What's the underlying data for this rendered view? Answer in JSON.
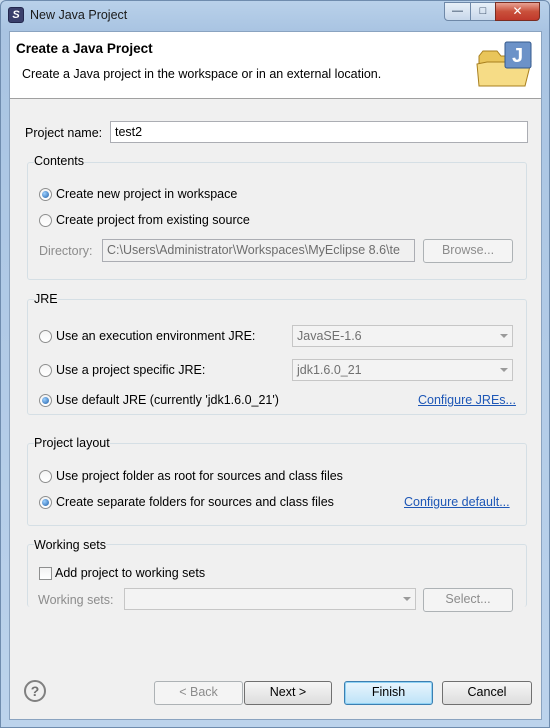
{
  "window": {
    "title": "New Java Project",
    "app_icon": "eclipse-icon",
    "controls": {
      "minimize": "—",
      "maximize": "□",
      "close": "✕"
    }
  },
  "header": {
    "title": "Create a Java Project",
    "description": "Create a Java project in the workspace or in an external location.",
    "graphic": "java-project-folder-icon"
  },
  "project_name": {
    "label": "Project name:",
    "value": "test2"
  },
  "contents": {
    "title": "Contents",
    "option_new": "Create new project in workspace",
    "option_existing": "Create project from existing source",
    "selected": "option_new",
    "directory_label": "Directory:",
    "directory_value": "C:\\Users\\Administrator\\Workspaces\\MyEclipse 8.6\\te",
    "browse": "Browse..."
  },
  "jre": {
    "title": "JRE",
    "option_env": "Use an execution environment JRE:",
    "env_value": "JavaSE-1.6",
    "option_specific": "Use a project specific JRE:",
    "specific_value": "jdk1.6.0_21",
    "option_default": "Use default JRE (currently 'jdk1.6.0_21')",
    "configure_link": "Configure JREs...",
    "selected": "option_default"
  },
  "layout": {
    "title": "Project layout",
    "option_root": "Use project folder as root for sources and class files",
    "option_separate": "Create separate folders for sources and class files",
    "configure_link": "Configure default...",
    "selected": "option_separate"
  },
  "working_sets": {
    "title": "Working sets",
    "add_label": "Add project to working sets",
    "add_checked": false,
    "sets_label": "Working sets:",
    "sets_value": "",
    "select_button": "Select..."
  },
  "footer": {
    "help": "?",
    "back": "< Back",
    "next": "Next >",
    "finish": "Finish",
    "cancel": "Cancel"
  }
}
